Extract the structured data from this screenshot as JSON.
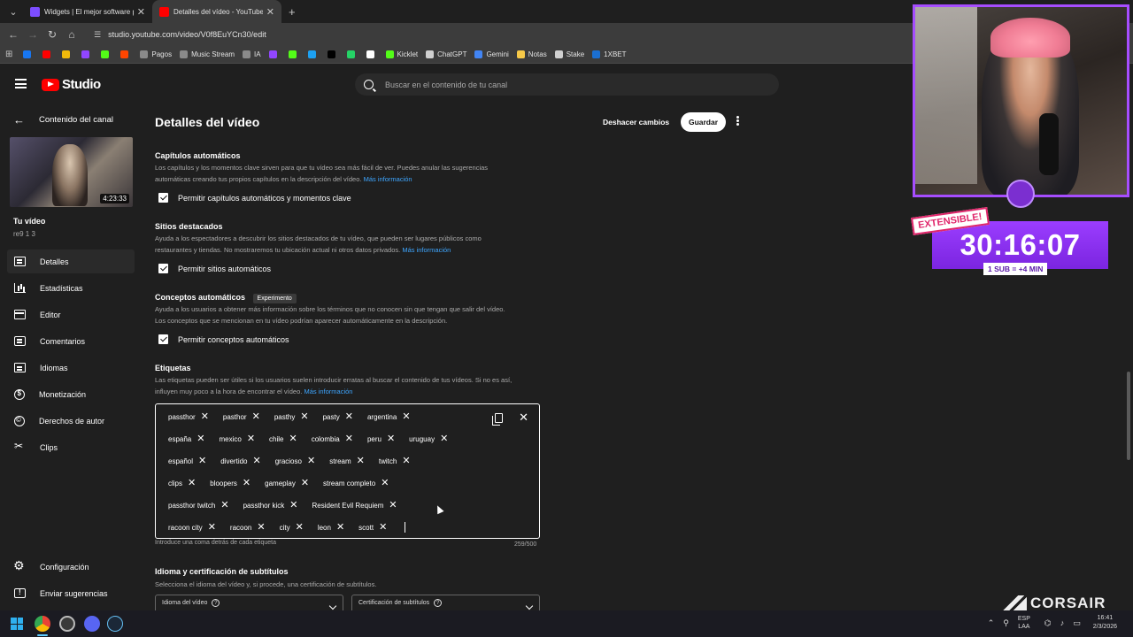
{
  "browser": {
    "tabs": [
      {
        "title": "Widgets | El mejor software pa",
        "favicon_color": "#7c4dff",
        "active": false
      },
      {
        "title": "Detalles del vídeo - YouTube St",
        "favicon_color": "#ff0000",
        "active": true
      }
    ],
    "new_tab": "+",
    "url": "studio.youtube.com/video/V0f8EuYCn30/edit",
    "bookmarks": [
      {
        "label": "",
        "color": "#1877f2"
      },
      {
        "label": "",
        "color": "#ff0000"
      },
      {
        "label": "",
        "color": "#f0b90b"
      },
      {
        "label": "",
        "color": "#9146ff"
      },
      {
        "label": "",
        "color": "#53fc18"
      },
      {
        "label": "",
        "color": "#ff4500"
      },
      {
        "label": "Pagos",
        "color": "#8a8a8a"
      },
      {
        "label": "Music Stream",
        "color": "#8a8a8a"
      },
      {
        "label": "IA",
        "color": "#8a8a8a"
      },
      {
        "label": "",
        "color": "#9146ff"
      },
      {
        "label": "",
        "color": "#53fc18"
      },
      {
        "label": "",
        "color": "#1da1f2"
      },
      {
        "label": "",
        "color": "#000000"
      },
      {
        "label": "",
        "color": "#25d366"
      },
      {
        "label": "",
        "color": "#ffffff"
      },
      {
        "label": "Kicklet",
        "color": "#53fc18"
      },
      {
        "label": "ChatGPT",
        "color": "#d0d0d0"
      },
      {
        "label": "Gemini",
        "color": "#4285f4"
      },
      {
        "label": "Notas",
        "color": "#f7c948"
      },
      {
        "label": "Stake",
        "color": "#d0d0d0"
      },
      {
        "label": "1XBET",
        "color": "#1b6fd1"
      }
    ]
  },
  "studio": {
    "logo_text": "Studio",
    "search_placeholder": "Buscar en el contenido de tu canal",
    "sidebar": {
      "back_label": "Contenido del canal",
      "video_duration": "4:23:33",
      "your_video": "Tu vídeo",
      "video_name": "re9 1 3",
      "items": [
        {
          "label": "Detalles",
          "icon": "details-icon",
          "active": true
        },
        {
          "label": "Estadísticas",
          "icon": "analytics-icon",
          "active": false
        },
        {
          "label": "Editor",
          "icon": "editor-icon",
          "active": false
        },
        {
          "label": "Comentarios",
          "icon": "comments-icon",
          "active": false
        },
        {
          "label": "Idiomas",
          "icon": "languages-icon",
          "active": false
        },
        {
          "label": "Monetización",
          "icon": "monetization-icon",
          "active": false
        },
        {
          "label": "Derechos de autor",
          "icon": "copyright-icon",
          "active": false
        },
        {
          "label": "Clips",
          "icon": "clips-icon",
          "active": false
        }
      ],
      "bottom_items": [
        {
          "label": "Configuración",
          "icon": "gear-icon"
        },
        {
          "label": "Enviar sugerencias",
          "icon": "feedback-icon"
        }
      ]
    },
    "main": {
      "title": "Detalles del vídeo",
      "undo_label": "Deshacer cambios",
      "save_label": "Guardar",
      "link_text": "Más información",
      "sections": {
        "chapters": {
          "title": "Capítulos automáticos",
          "desc1": "Los capítulos y los momentos clave sirven para que tu vídeo sea más fácil de ver. Puedes anular las sugerencias",
          "desc2": "automáticas creando tus propios capítulos en la descripción del vídeo.",
          "checkbox": "Permitir capítulos automáticos y momentos clave"
        },
        "places": {
          "title": "Sitios destacados",
          "desc1": "Ayuda a los espectadores a descubrir los sitios destacados de tu vídeo, que pueden ser lugares públicos como",
          "desc2": "restaurantes y tiendas. No mostraremos tu ubicación actual ni otros datos privados.",
          "checkbox": "Permitir sitios automáticos"
        },
        "concepts": {
          "title": "Conceptos automáticos",
          "badge": "Experimento",
          "desc1": "Ayuda a los usuarios a obtener más información sobre los términos que no conocen sin que tengan que salir del vídeo.",
          "desc2": "Los conceptos que se mencionan en tu vídeo podrían aparecer automáticamente en la descripción.",
          "checkbox": "Permitir conceptos automáticos"
        },
        "tags": {
          "title": "Etiquetas",
          "desc1": "Las etiquetas pueden ser útiles si los usuarios suelen introducir erratas al buscar el contenido de tus vídeos. Si no es así,",
          "desc2": "influyen muy poco a la hora de encontrar el vídeo.",
          "rows": [
            [
              "passthor",
              "pasthor",
              "pasthy",
              "pasty",
              "argentina"
            ],
            [
              "españa",
              "mexico",
              "chile",
              "colombia",
              "peru",
              "uruguay"
            ],
            [
              "español",
              "divertido",
              "gracioso",
              "stream",
              "twitch"
            ],
            [
              "clips",
              "bloopers",
              "gameplay",
              "stream completo"
            ],
            [
              "passthor twitch",
              "passthor kick",
              "Resident Evil Requiem"
            ],
            [
              "racoon city",
              "racoon",
              "city",
              "leon",
              "scott"
            ]
          ],
          "hint": "Introduce una coma detrás de cada etiqueta",
          "count": "259/500"
        },
        "language": {
          "title": "Idioma y certificación de subtítulos",
          "desc": "Selecciona el idioma del vídeo y, si procede, una certificación de subtítulos.",
          "video_language_label": "Idioma del vídeo",
          "caption_cert_label": "Certificación de subtítulos"
        }
      }
    }
  },
  "overlay": {
    "extensible_badge": "EXTENSIBLE!",
    "timer": "30:16:07",
    "sub_rule": "1 SUB = +4 MIN",
    "sponsor": "CORSAIR"
  },
  "taskbar": {
    "lang_top": "ESP",
    "lang_bottom": "LAA",
    "time": "16:41",
    "date": "2/3/2026"
  }
}
